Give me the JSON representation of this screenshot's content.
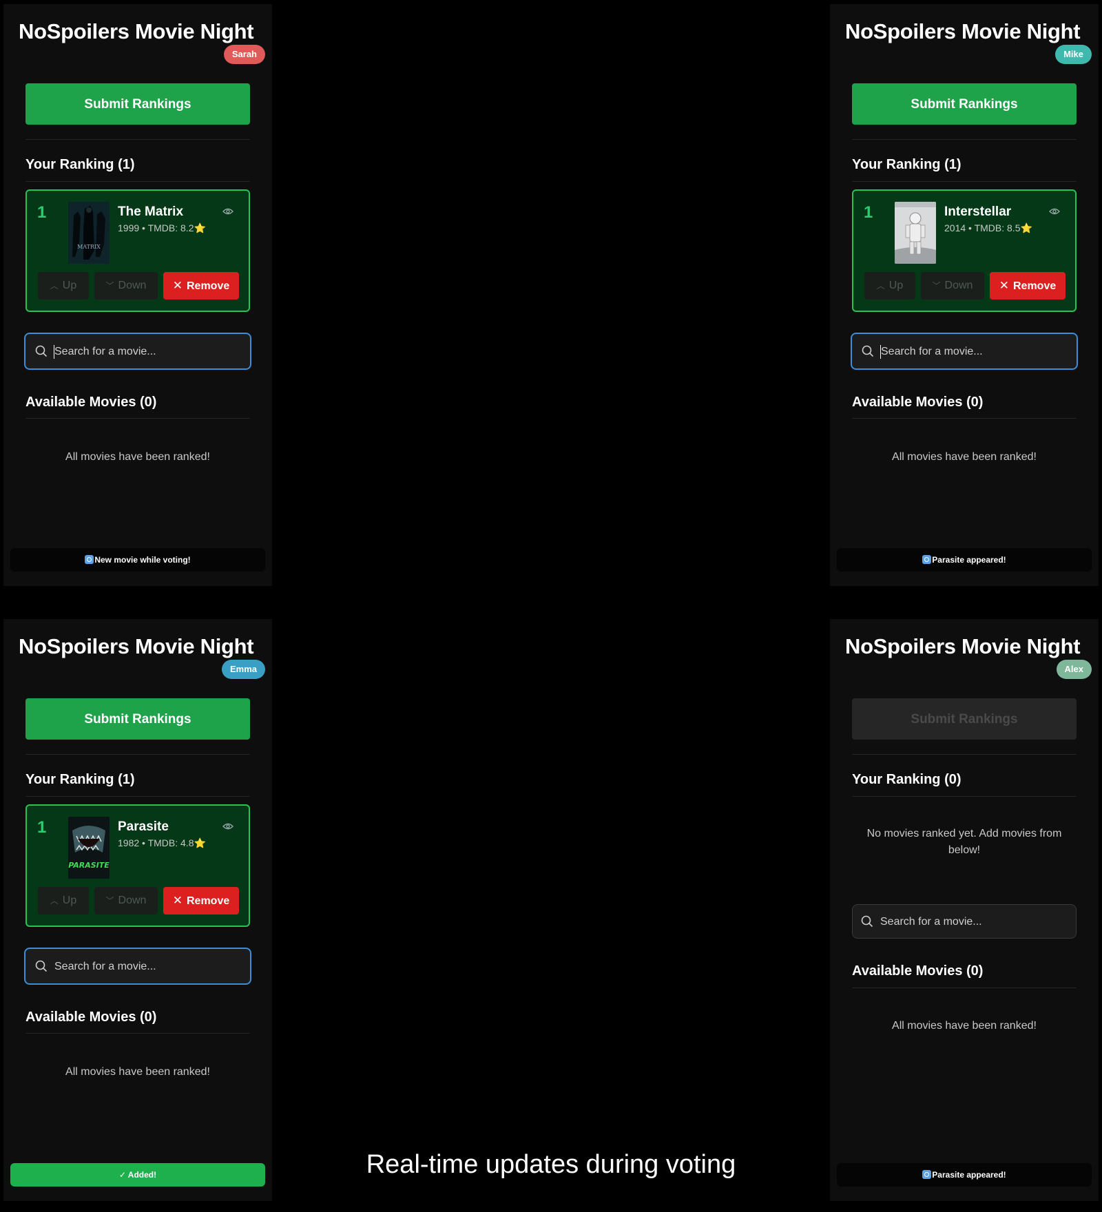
{
  "app_title": "NoSpoilers Movie Night",
  "submit_label": "Submit Rankings",
  "search_placeholder": "Search for a movie...",
  "labels": {
    "up": "Up",
    "down": "Down",
    "remove": "Remove",
    "all_ranked": "All movies have been ranked!",
    "no_ranked": "No movies ranked yet. Add movies from below!"
  },
  "panels": [
    {
      "user": "Sarah",
      "user_color": "#e05a5a",
      "ranking_header": "Your Ranking (1)",
      "available_header": "Available Movies (0)",
      "movie": {
        "rank": "1",
        "title": "The Matrix",
        "meta": "1999 • TMDB: 8.2⭐"
      },
      "toast": "New movie while voting!"
    },
    {
      "user": "Mike",
      "user_color": "#3fb8ae",
      "ranking_header": "Your Ranking (1)",
      "available_header": "Available Movies (0)",
      "movie": {
        "rank": "1",
        "title": "Interstellar",
        "meta": "2014 • TMDB: 8.5⭐"
      },
      "toast": "Parasite appeared!"
    },
    {
      "user": "Emma",
      "user_color": "#3a9fc4",
      "ranking_header": "Your Ranking (1)",
      "available_header": "Available Movies (0)",
      "movie": {
        "rank": "1",
        "title": "Parasite",
        "meta": "1982 • TMDB: 4.8⭐"
      },
      "toast": "✓ Added!"
    },
    {
      "user": "Alex",
      "user_color": "#7fb79a",
      "ranking_header": "Your Ranking (0)",
      "available_header": "Available Movies (0)",
      "toast": "Parasite appeared!"
    }
  ],
  "caption": "Real-time updates during voting"
}
